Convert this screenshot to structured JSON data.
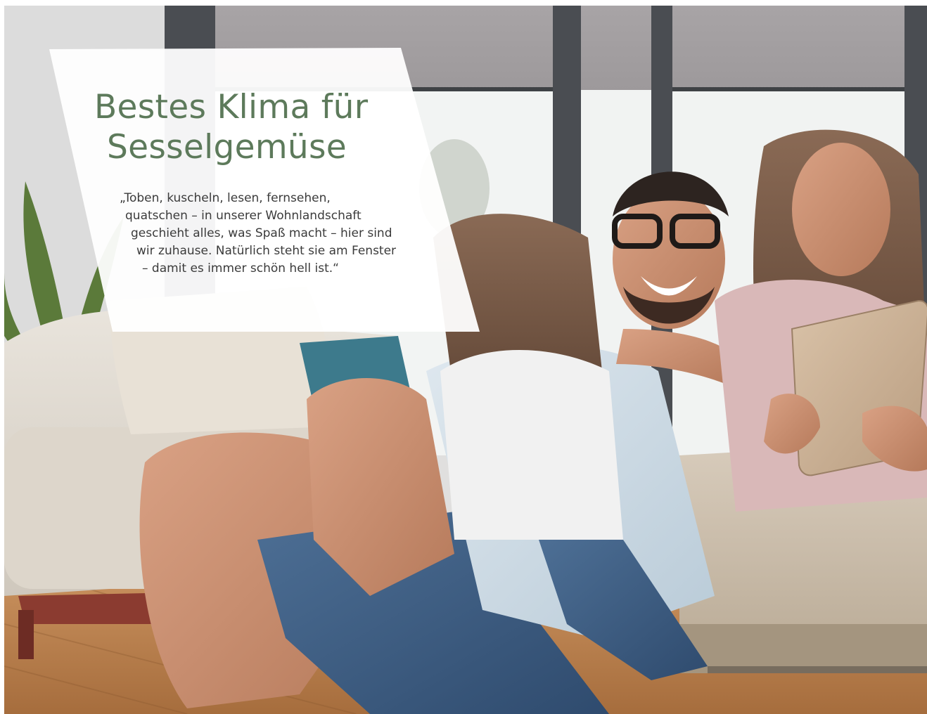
{
  "hero": {
    "headline": {
      "line1": "Bestes Klima für",
      "line2": "Sesselgemüse"
    },
    "quote": {
      "lines": [
        "„Toben, kuscheln, lesen, fernsehen,",
        "quatschen – in unserer Wohnlandschaft",
        "geschieht alles, was Spaß macht – hier sind",
        "wir zuhause. Natürlich steht sie am Fenster",
        "– damit es immer schön hell ist.“"
      ]
    }
  },
  "colors": {
    "headline": "#5d7a5b",
    "body_text": "#3b3b3b",
    "panel": "#ffffff"
  }
}
